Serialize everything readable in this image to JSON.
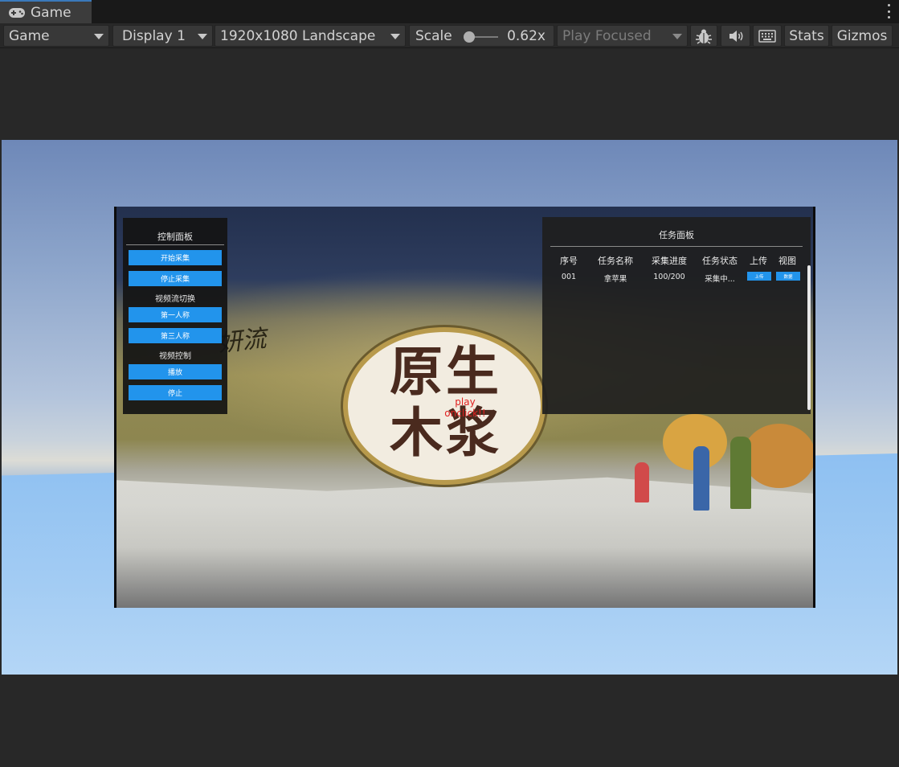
{
  "window": {
    "tab_label": "Game",
    "tab_icon": "gamepad-icon"
  },
  "toolbar": {
    "view_mode": "Game",
    "display": "Display 1",
    "resolution": "1920x1080 Landscape",
    "scale_label": "Scale",
    "scale_value": "0.62x",
    "play_mode": "Play Focused",
    "stats": "Stats",
    "gizmos": "Gizmos",
    "icons": [
      "bug-icon",
      "audio-mute-icon",
      "keyboard-icon"
    ]
  },
  "control_panel": {
    "title": "控制面板",
    "start_capture": "开始采集",
    "stop_capture": "停止采集",
    "stream_switch_label": "视频流切换",
    "first_person": "第一人称",
    "third_person": "第三人称",
    "video_control_label": "视频控制",
    "play": "播放",
    "stop": "停止"
  },
  "task_panel": {
    "title": "任务面板",
    "columns": [
      "序号",
      "任务名称",
      "采集进度",
      "任务状态",
      "上传",
      "视图"
    ],
    "rows": [
      {
        "id": "001",
        "name": "拿苹果",
        "progress": "100/200",
        "status": "采集中...",
        "upload_label": "上传",
        "view_label": "数据"
      }
    ]
  },
  "camera_overlay": {
    "play_label_line1": "play",
    "play_label_line2": "onclick!!",
    "logo_line1": "原生",
    "logo_line2": "木浆"
  },
  "colors": {
    "accent_blue": "#2294ec",
    "tab_highlight": "#3a79bb",
    "play_label_red": "#e02020"
  }
}
